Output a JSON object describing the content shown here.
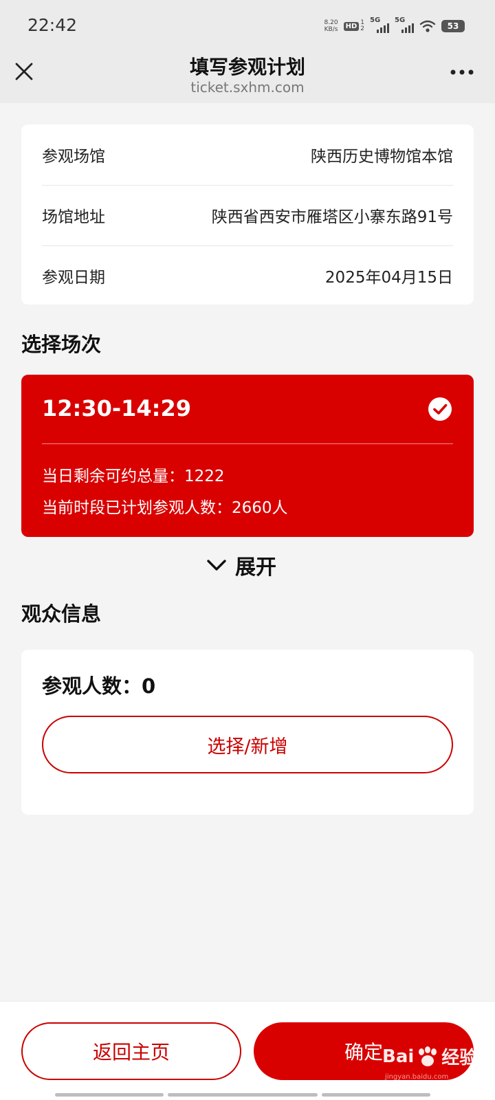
{
  "status_bar": {
    "time": "22:42",
    "net_speed_value": "8.20",
    "net_speed_unit": "KB/s",
    "hd_label": "HD",
    "hd_sub_top": "1",
    "hd_sub_bottom": "2",
    "sim1_label": "5G",
    "sim2_label": "5G",
    "battery": "53",
    "icons": [
      "hd-icon",
      "signal-icon",
      "wifi-icon",
      "battery-icon"
    ]
  },
  "nav": {
    "title": "填写参观计划",
    "url": "ticket.sxhm.com",
    "close_icon": "close-icon",
    "more_icon": "more-icon"
  },
  "info": {
    "rows": [
      {
        "label": "参观场馆",
        "value": "陕西历史博物馆本馆"
      },
      {
        "label": "场馆地址",
        "value": "陕西省西安市雁塔区小寨东路91号"
      },
      {
        "label": "参观日期",
        "value": "2025年04月15日"
      }
    ]
  },
  "session": {
    "section_title": "选择场次",
    "time_slot": "12:30-14:29",
    "remaining": "当日剩余可约总量：1222",
    "planned": "当前时段已计划参观人数：2660人",
    "selected": true,
    "expand_label": "展开"
  },
  "visitor": {
    "section_title": "观众信息",
    "count_text": "参观人数：0",
    "select_button": "选择/新增"
  },
  "footer": {
    "home_button": "返回主页",
    "confirm_button": "确定"
  },
  "watermark": {
    "text_a": "Bai",
    "text_b": "经验",
    "sub": "jingyan.baidu.com"
  },
  "colors": {
    "accent": "#d90000",
    "background": "#f4f4f4",
    "card": "#ffffff"
  }
}
